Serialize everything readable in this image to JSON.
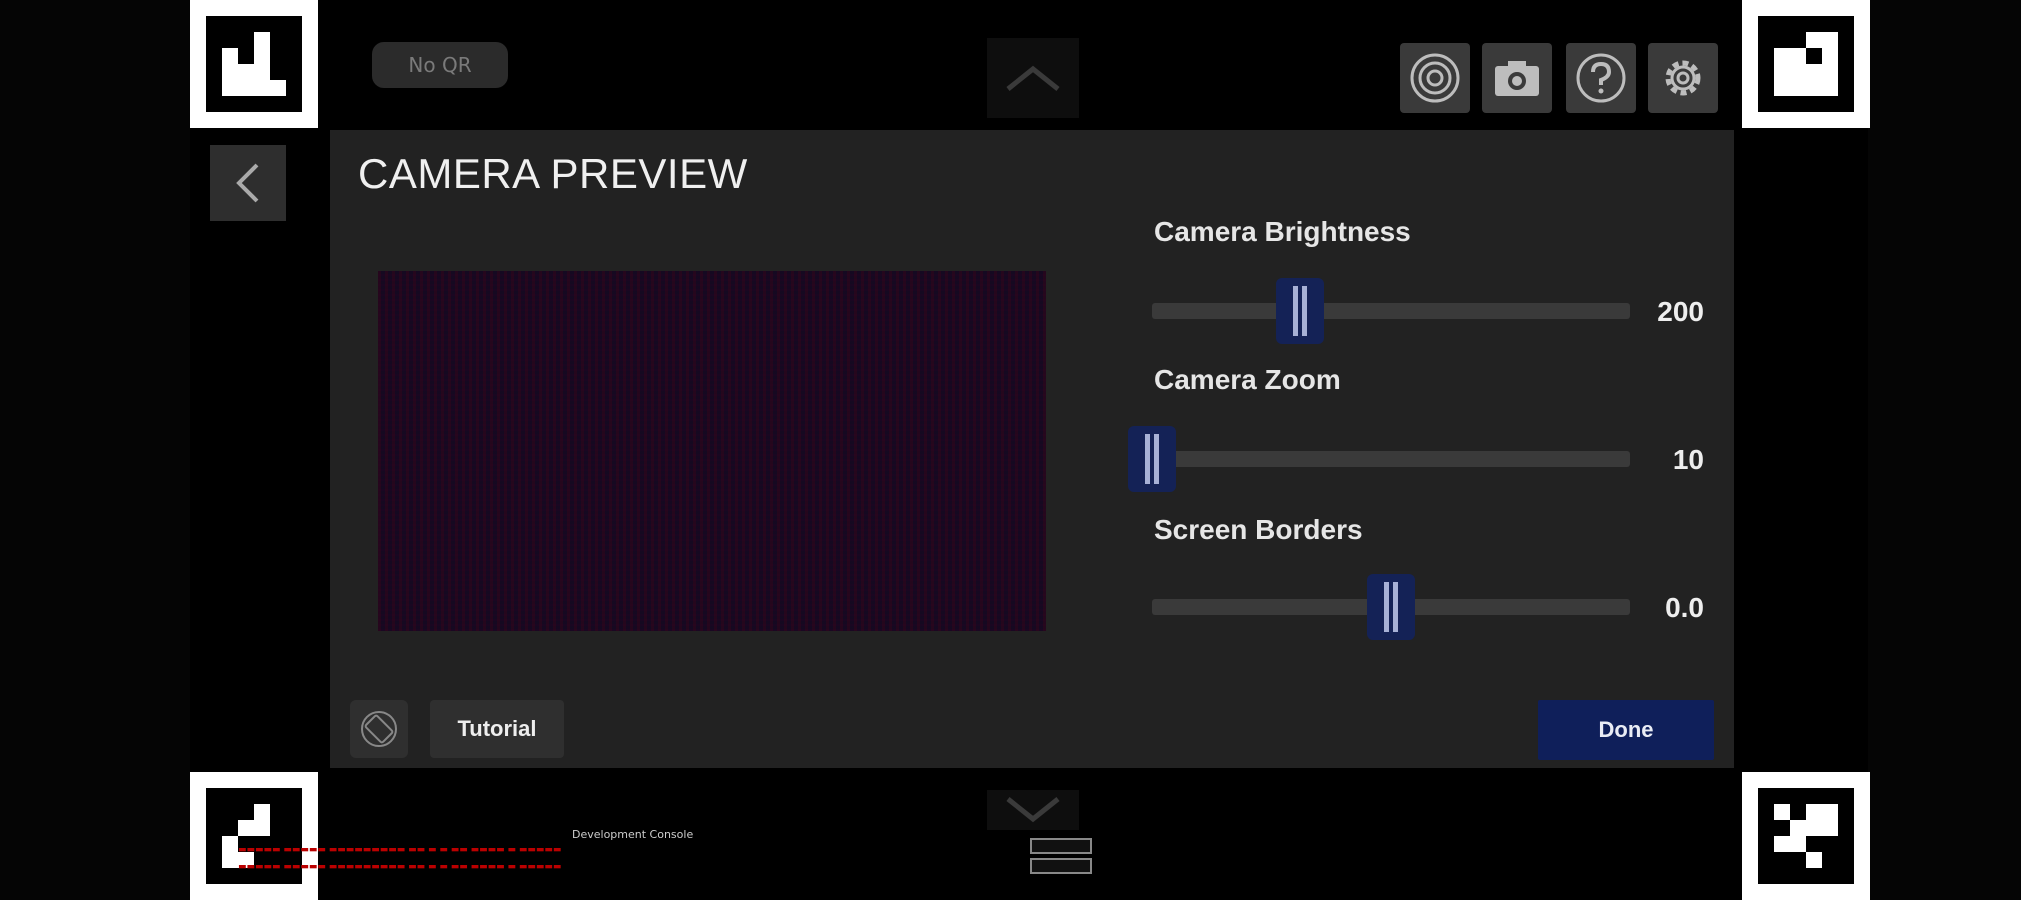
{
  "status": {
    "qr_label": "No QR"
  },
  "toolbar": {
    "icons": [
      "target-icon",
      "camera-icon",
      "help-icon",
      "settings-icon"
    ]
  },
  "panel": {
    "title": "CAMERA PREVIEW",
    "sliders": [
      {
        "label": "Camera Brightness",
        "value_text": "200",
        "fraction": 0.31
      },
      {
        "label": "Camera Zoom",
        "value_text": "10",
        "fraction": 0.0
      },
      {
        "label": "Screen Borders",
        "value_text": "0.0",
        "fraction": 0.5
      }
    ],
    "tutorial_label": "Tutorial",
    "done_label": "Done"
  },
  "dev_console": {
    "title": "Development Console"
  },
  "colors": {
    "panel_bg": "#222222",
    "accent": "#142256",
    "done_bg": "#0f1f5a"
  }
}
